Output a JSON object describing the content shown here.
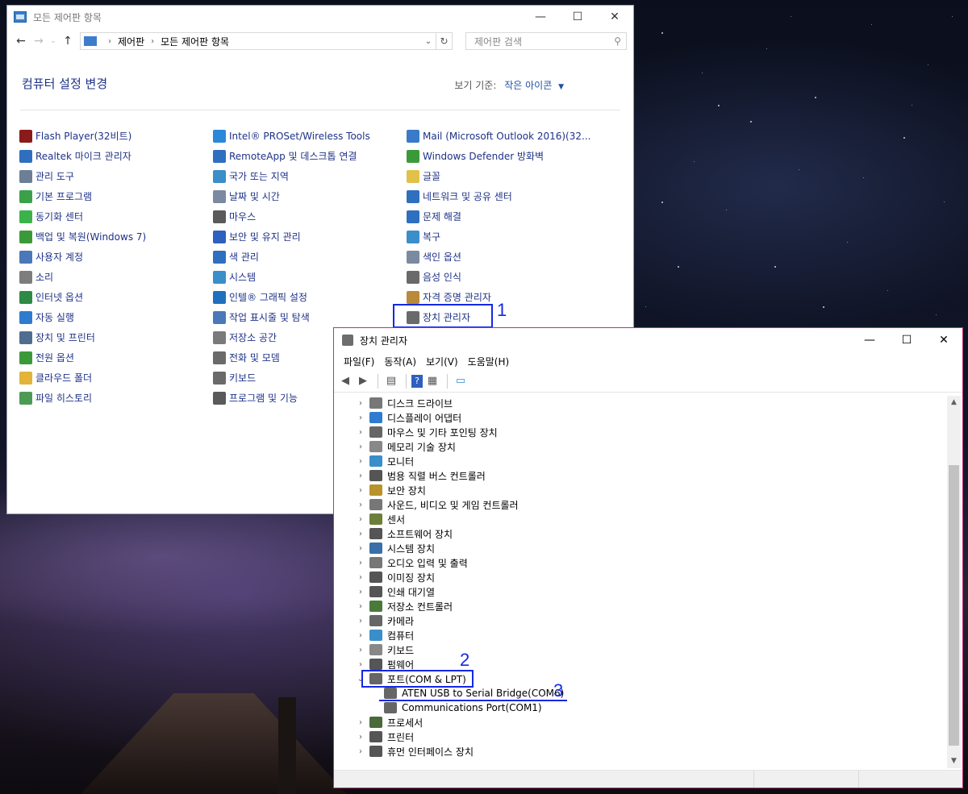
{
  "control_panel": {
    "title": "모든 제어판 항목",
    "breadcrumb": [
      "제어판",
      "모든 제어판 항목"
    ],
    "search_placeholder": "제어판 검색",
    "heading": "컴퓨터 설정 변경",
    "view_by_label": "보기 기준:",
    "view_by_value": "작은 아이콘",
    "columns": [
      [
        {
          "label": "Flash Player(32비트)",
          "icon": "flash-icon",
          "color": "#8b1a1a"
        },
        {
          "label": "Realtek 마이크 관리자",
          "icon": "realtek-icon",
          "color": "#2f6fbf"
        },
        {
          "label": "관리 도구",
          "icon": "admin-tools-icon",
          "color": "#6d7f96"
        },
        {
          "label": "기본 프로그램",
          "icon": "default-programs-icon",
          "color": "#3aa14a"
        },
        {
          "label": "동기화 센터",
          "icon": "sync-center-icon",
          "color": "#3cb34a"
        },
        {
          "label": "백업 및 복원(Windows 7)",
          "icon": "backup-icon",
          "color": "#3a9a3a"
        },
        {
          "label": "사용자 계정",
          "icon": "user-accounts-icon",
          "color": "#4a78b8"
        },
        {
          "label": "소리",
          "icon": "sound-icon",
          "color": "#7d7d7d"
        },
        {
          "label": "인터넷 옵션",
          "icon": "internet-options-icon",
          "color": "#2e8a44"
        },
        {
          "label": "자동 실행",
          "icon": "autoplay-icon",
          "color": "#2f7bd0"
        },
        {
          "label": "장치 및 프린터",
          "icon": "devices-printers-icon",
          "color": "#4f6d8f"
        },
        {
          "label": "전원 옵션",
          "icon": "power-options-icon",
          "color": "#3a9a3a"
        },
        {
          "label": "클라우드 폴더",
          "icon": "cloud-folder-icon",
          "color": "#e2b437"
        },
        {
          "label": "파일 히스토리",
          "icon": "file-history-icon",
          "color": "#4d9a55"
        }
      ],
      [
        {
          "label": "Intel® PROSet/Wireless Tools",
          "icon": "wireless-icon",
          "color": "#2b88d8"
        },
        {
          "label": "RemoteApp 및 데스크톱 연결",
          "icon": "remoteapp-icon",
          "color": "#2f6fbf"
        },
        {
          "label": "국가 또는 지역",
          "icon": "region-icon",
          "color": "#3a8ec9"
        },
        {
          "label": "날짜 및 시간",
          "icon": "date-time-icon",
          "color": "#7a8aa0"
        },
        {
          "label": "마우스",
          "icon": "mouse-icon",
          "color": "#5a5a5a"
        },
        {
          "label": "보안 및 유지 관리",
          "icon": "security-flag-icon",
          "color": "#2f5fbf"
        },
        {
          "label": "색 관리",
          "icon": "color-management-icon",
          "color": "#2f6fbf"
        },
        {
          "label": "시스템",
          "icon": "system-icon",
          "color": "#3a8ec9"
        },
        {
          "label": "인텔® 그래픽 설정",
          "icon": "intel-graphics-icon",
          "color": "#1f6fbf"
        },
        {
          "label": "작업 표시줄 및 탐색",
          "icon": "taskbar-icon",
          "color": "#4a78b8"
        },
        {
          "label": "저장소 공간",
          "icon": "storage-spaces-icon",
          "color": "#7a7a7a"
        },
        {
          "label": "전화 및 모뎀",
          "icon": "phone-modem-icon",
          "color": "#6a6a6a"
        },
        {
          "label": "키보드",
          "icon": "keyboard-icon",
          "color": "#6a6a6a"
        },
        {
          "label": "프로그램 및 기능",
          "icon": "programs-features-icon",
          "color": "#5a5a5a"
        }
      ],
      [
        {
          "label": "Mail (Microsoft Outlook 2016)(32...",
          "icon": "mail-icon",
          "color": "#3a7ac8"
        },
        {
          "label": "Windows Defender 방화벽",
          "icon": "firewall-icon",
          "color": "#3a9a3a"
        },
        {
          "label": "글꼴",
          "icon": "fonts-icon",
          "color": "#e2c14a"
        },
        {
          "label": "네트워크 및 공유 센터",
          "icon": "network-icon",
          "color": "#2f6fbf"
        },
        {
          "label": "문제 해결",
          "icon": "troubleshooting-icon",
          "color": "#2f6fbf"
        },
        {
          "label": "복구",
          "icon": "recovery-icon",
          "color": "#3a8ec9"
        },
        {
          "label": "색인 옵션",
          "icon": "indexing-icon",
          "color": "#7a8aa0"
        },
        {
          "label": "음성 인식",
          "icon": "speech-icon",
          "color": "#6a6a6a"
        },
        {
          "label": "자격 증명 관리자",
          "icon": "credential-icon",
          "color": "#b88a3a"
        },
        {
          "label": "장치 관리자",
          "icon": "device-manager-icon",
          "color": "#6a6a6a"
        }
      ]
    ]
  },
  "annotations": {
    "n1": "1",
    "n2": "2",
    "n3": "3"
  },
  "device_manager": {
    "title": "장치 관리자",
    "menu": [
      "파일(F)",
      "동작(A)",
      "보기(V)",
      "도움말(H)"
    ],
    "tree": [
      {
        "label": "디스크 드라이브",
        "icon": "disk-drive-icon",
        "color": "#777777"
      },
      {
        "label": "디스플레이 어댑터",
        "icon": "display-adapter-icon",
        "color": "#2f7bd0"
      },
      {
        "label": "마우스 및 기타 포인팅 장치",
        "icon": "mouse-icon",
        "color": "#666666"
      },
      {
        "label": "메모리 기술 장치",
        "icon": "memory-device-icon",
        "color": "#888888"
      },
      {
        "label": "모니터",
        "icon": "monitor-icon",
        "color": "#3a8ec9"
      },
      {
        "label": "범용 직렬 버스 컨트롤러",
        "icon": "usb-icon",
        "color": "#555555"
      },
      {
        "label": "보안 장치",
        "icon": "security-device-icon",
        "color": "#b8922a"
      },
      {
        "label": "사운드, 비디오 및 게임 컨트롤러",
        "icon": "sound-icon",
        "color": "#777777"
      },
      {
        "label": "센서",
        "icon": "sensor-icon",
        "color": "#6b7f3a"
      },
      {
        "label": "소프트웨어 장치",
        "icon": "software-device-icon",
        "color": "#555555"
      },
      {
        "label": "시스템 장치",
        "icon": "system-device-icon",
        "color": "#3a6fa8"
      },
      {
        "label": "오디오 입력 및 출력",
        "icon": "audio-icon",
        "color": "#777777"
      },
      {
        "label": "이미징 장치",
        "icon": "imaging-icon",
        "color": "#555555"
      },
      {
        "label": "인쇄 대기열",
        "icon": "print-queue-icon",
        "color": "#555555"
      },
      {
        "label": "저장소 컨트롤러",
        "icon": "storage-controller-icon",
        "color": "#4a7a3a"
      },
      {
        "label": "카메라",
        "icon": "camera-icon",
        "color": "#666666"
      },
      {
        "label": "컴퓨터",
        "icon": "computer-icon",
        "color": "#3a8ec9"
      },
      {
        "label": "키보드",
        "icon": "keyboard-icon",
        "color": "#888888"
      },
      {
        "label": "펌웨어",
        "icon": "firmware-icon",
        "color": "#555555"
      },
      {
        "label": "포트(COM & LPT)",
        "icon": "port-icon",
        "color": "#666666",
        "expanded": true
      },
      {
        "label": "ATEN USB to Serial Bridge(COM6)",
        "icon": "port-icon",
        "color": "#666666",
        "child": true
      },
      {
        "label": "Communications Port(COM1)",
        "icon": "port-icon",
        "color": "#666666",
        "child": true
      },
      {
        "label": "프로세서",
        "icon": "processor-icon",
        "color": "#4a6a3a"
      },
      {
        "label": "프린터",
        "icon": "printer-icon",
        "color": "#555555"
      },
      {
        "label": "휴먼 인터페이스 장치",
        "icon": "hid-icon",
        "color": "#555555"
      }
    ]
  }
}
